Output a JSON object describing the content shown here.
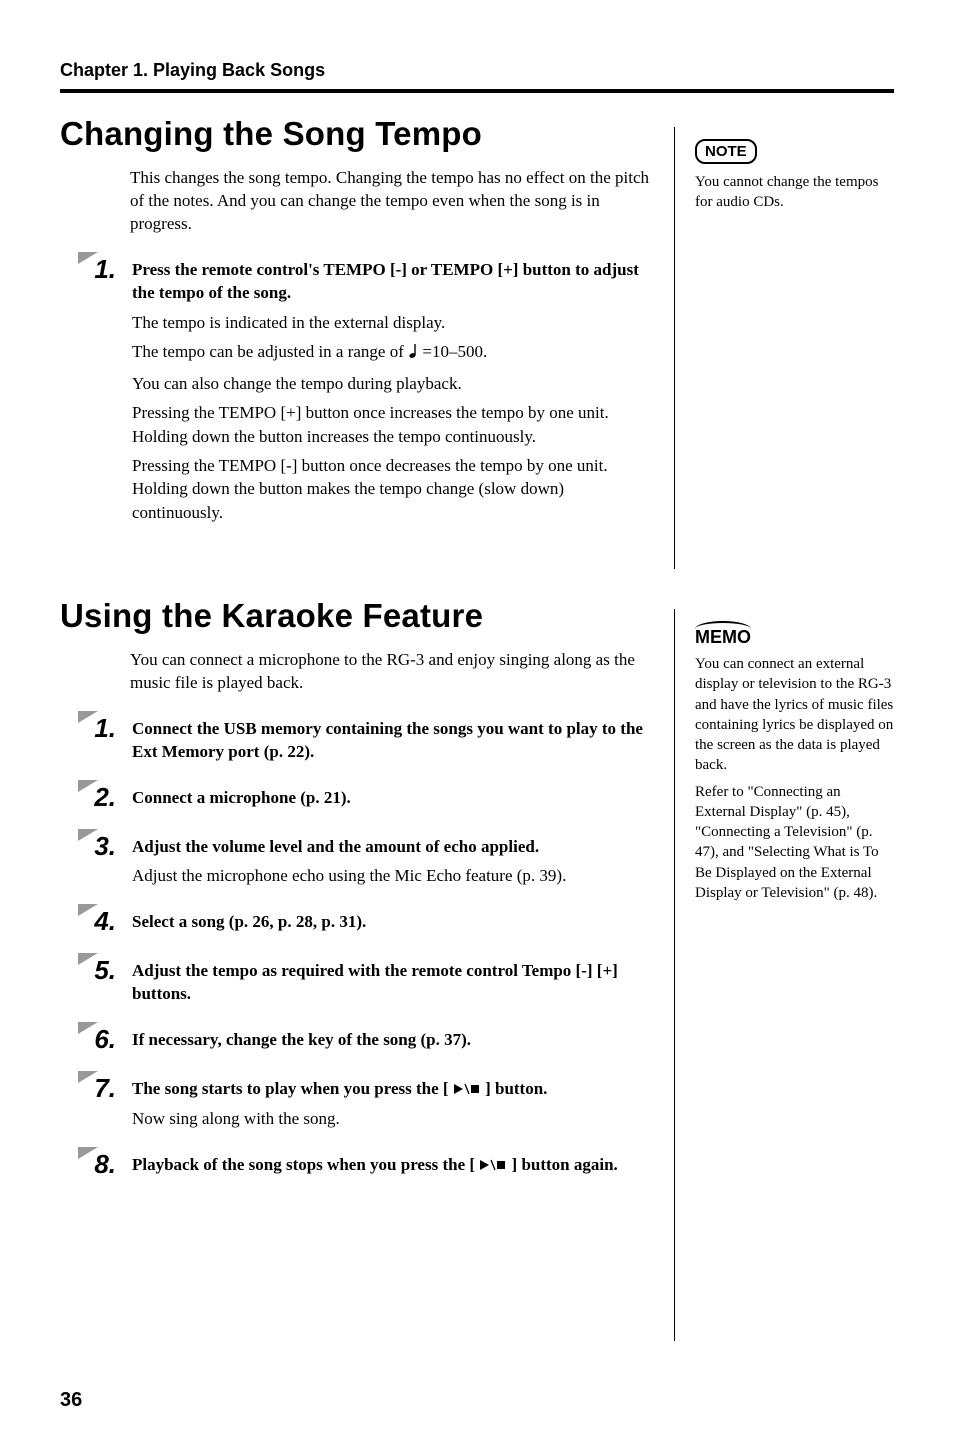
{
  "chapter_header": "Chapter 1. Playing Back Songs",
  "section1": {
    "title": "Changing the Song Tempo",
    "intro": "This changes the song tempo. Changing the tempo has no effect on the pitch of the notes. And you can change the tempo even when the song is in progress.",
    "note_label": "NOTE",
    "note_text": "You cannot change the tempos for audio CDs.",
    "step1": {
      "num": "1.",
      "bold": "Press the remote control's TEMPO [-] or TEMPO [+] button to adjust the tempo of the song.",
      "p1": "The tempo is indicated in the external display.",
      "p2_pre": "The tempo can be adjusted in a range of ",
      "p2_post": " =10–500.",
      "p3": "You can also change the tempo during playback.",
      "p4": "Pressing the TEMPO [+] button once increases the tempo by one unit. Holding down the button increases the tempo continuously.",
      "p5": "Pressing the TEMPO [-] button once decreases the tempo by one unit. Holding down the button makes the tempo change (slow down) continuously."
    }
  },
  "section2": {
    "title": "Using the Karaoke Feature",
    "intro": "You can connect a microphone to the RG-3 and enjoy singing along as the music file is played back.",
    "memo_label": "MEMO",
    "memo_text1": "You can connect an external display or television to the RG-3 and have the lyrics of music files containing lyrics be displayed on the screen as the data is played back.",
    "memo_text2": "Refer to \"Connecting an External Display\" (p. 45), \"Connecting a Television\" (p. 47), and \"Selecting What is To Be Displayed on the External Display or Television\" (p. 48).",
    "steps": [
      {
        "num": "1.",
        "bold": "Connect the USB memory containing the songs you want to play to the Ext Memory port (p. 22)."
      },
      {
        "num": "2.",
        "bold": "Connect a microphone (p. 21)."
      },
      {
        "num": "3.",
        "bold": "Adjust the volume level and the amount of echo applied.",
        "plain": "Adjust the microphone echo using the Mic Echo feature (p. 39)."
      },
      {
        "num": "4.",
        "bold": "Select a song (p. 26, p. 28, p. 31)."
      },
      {
        "num": "5.",
        "bold": "Adjust the tempo as required with the remote control Tempo [-] [+] buttons."
      },
      {
        "num": "6.",
        "bold": "If necessary, change the key of the song (p. 37)."
      },
      {
        "num": "7.",
        "bold_pre": "The song starts to play when you press the [ ",
        "bold_post": " ] button.",
        "plain": "Now sing along with the song."
      },
      {
        "num": "8.",
        "bold_pre": "Playback of the song stops when you press the [ ",
        "bold_post": " ] button again."
      }
    ]
  },
  "page_number": "36"
}
